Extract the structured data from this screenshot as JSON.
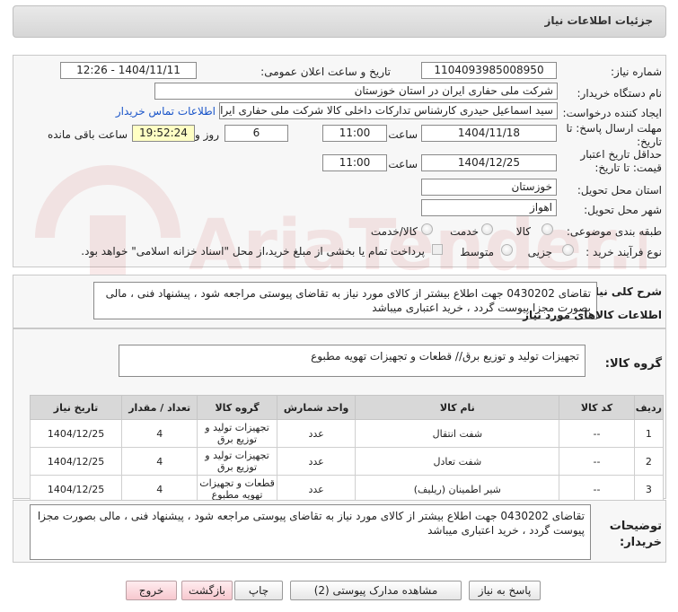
{
  "header": {
    "title": "جزئیات اطلاعات نیاز"
  },
  "form": {
    "need_number_label": "شماره نیاز:",
    "need_number": "1104093985008950",
    "announce_label": "تاریخ و ساعت اعلان عمومی:",
    "announce_value": "1404/11/11 - 12:26",
    "buyer_org_label": "نام دستگاه خریدار:",
    "buyer_org": "شرکت ملی حفاری ایران در استان خوزستان",
    "requester_label": "ایجاد کننده درخواست:",
    "requester": "سید اسماعیل حیدری کارشناس تدارکات داخلی کالا شرکت ملی حفاری ایران در",
    "contact_link": "اطلاعات تماس خریدار",
    "deadline_label": "مهلت ارسال پاسخ: تا تاریخ:",
    "deadline_date": "1404/11/18",
    "hour_label": "ساعت",
    "deadline_time": "11:00",
    "days_value": "6",
    "days_word": "روز و",
    "remaining_time": "19:52:24",
    "remaining_label": "ساعت باقی مانده",
    "validity_label": "حداقل تاریخ اعتبار قیمت: تا تاریخ:",
    "validity_date": "1404/12/25",
    "validity_time": "11:00",
    "province_label": "استان محل تحویل:",
    "province": "خوزستان",
    "city_label": "شهر محل تحویل:",
    "city": "اهواز",
    "category_label": "طبقه بندی موضوعی:",
    "category_options": [
      "کالا",
      "خدمت",
      "کالا/خدمت"
    ],
    "process_label": "نوع فرآیند خرید :",
    "process_options": [
      "جزیی",
      "متوسط"
    ],
    "payment_note": "پرداخت تمام یا بخشی از مبلغ خرید،از محل \"اسناد خزانه اسلامی\" خواهد بود."
  },
  "summary": {
    "label": "شرح کلی نیاز:",
    "text": "تقاضای 0430202 جهت اطلاع بیشتر از کالای مورد نیاز به تقاضای پیوستی مراجعه شود ، پیشنهاد فنی ، مالی بصورت مجزا پیوست گردد ، خرید اعتباری میباشد"
  },
  "goods": {
    "section_title": "اطلاعات کالاهای مورد نیاز",
    "group_label": "گروه کالا:",
    "group_value": "تجهیزات تولید و توزیع برق//  قطعات و تجهیزات تهویه مطبوع"
  },
  "table": {
    "headers": [
      "ردیف",
      "کد کالا",
      "نام کالا",
      "واحد شمارش",
      "گروه کالا",
      "تعداد / مقدار",
      "تاریخ نیاز"
    ],
    "rows": [
      {
        "row": "1",
        "code": "--",
        "name": "شفت انتقال",
        "unit": "عدد",
        "group": "تجهیزات تولید و توزیع برق",
        "qty": "4",
        "date": "1404/12/25"
      },
      {
        "row": "2",
        "code": "--",
        "name": "شفت تعادل",
        "unit": "عدد",
        "group": "تجهیزات تولید و توزیع برق",
        "qty": "4",
        "date": "1404/12/25"
      },
      {
        "row": "3",
        "code": "--",
        "name": "شیر اطمینان (ریلیف)",
        "unit": "عدد",
        "group": "قطعات و تجهیزات تهویه مطبوع",
        "qty": "4",
        "date": "1404/12/25"
      }
    ]
  },
  "buyer_notes": {
    "label": "توضیحات خریدار:",
    "text": "تقاضای 0430202 جهت اطلاع بیشتر از کالای مورد نیاز به تقاضای پیوستی مراجعه شود ، پیشنهاد فنی ، مالی بصورت مجزا پیوست گردد ، خرید اعتباری میباشد"
  },
  "buttons": {
    "reply": "پاسخ به نیاز",
    "docs": "مشاهده مدارک پیوستی (2)",
    "print": "چاپ",
    "back": "بازگشت",
    "exit": "خروج"
  },
  "watermark": {
    "text": "AriaTender.net"
  },
  "colors": {
    "link": "#1a55c9",
    "header_bg": "#dcdcdc",
    "remaining_bg": "#ffffc4",
    "pink_button": "#f7c8cf"
  }
}
